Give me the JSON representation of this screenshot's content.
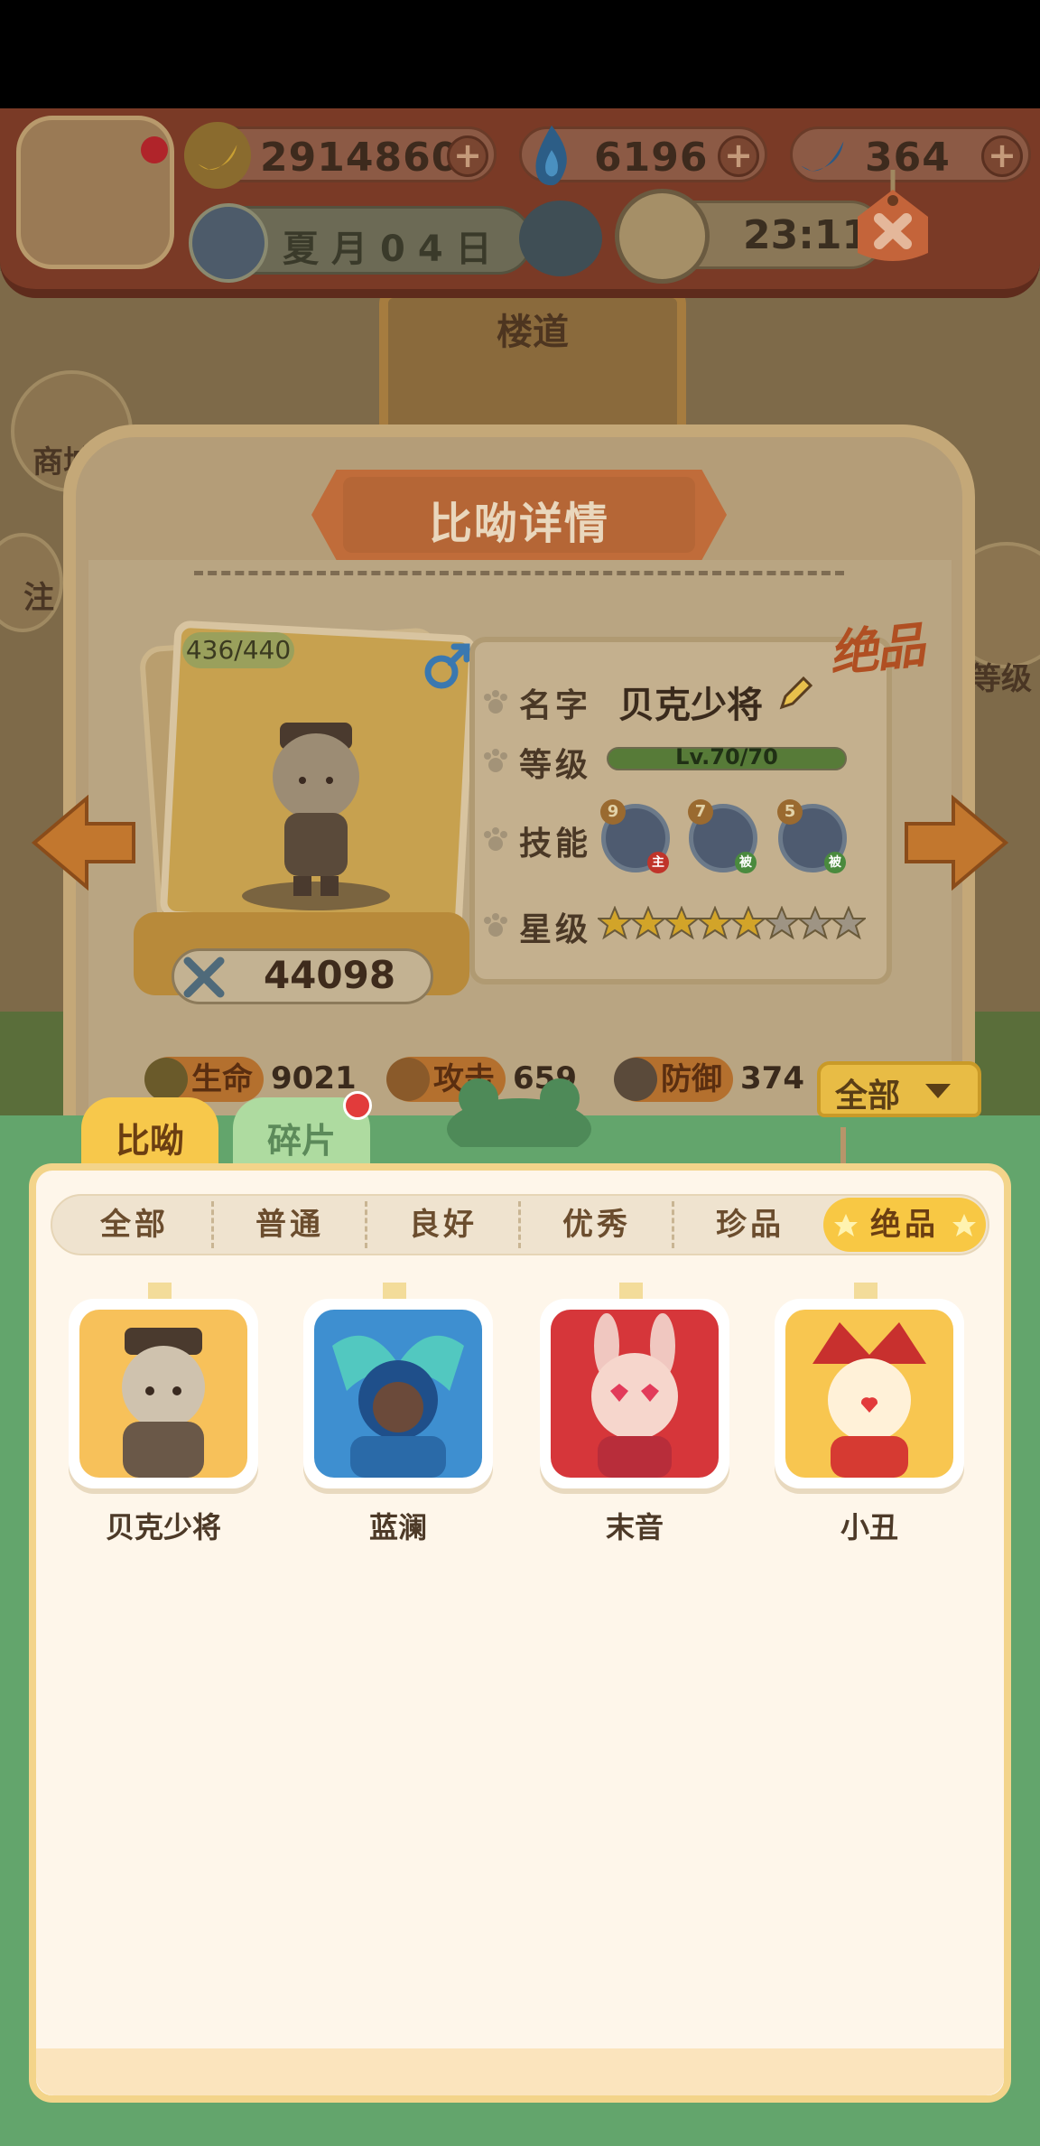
{
  "colors": {
    "sheet_green": "#63a56c",
    "tab_active": "#f7c84b",
    "panel_bg": "#fef6ea",
    "notification_red": "#e23b3b",
    "ribbon": "#c06c3a"
  },
  "header": {
    "resources": [
      {
        "icon": "banana-icon",
        "value": "2914860"
      },
      {
        "icon": "blue-flame-icon",
        "value": "6196"
      },
      {
        "icon": "blue-banana-icon",
        "value": "364"
      }
    ],
    "date_text": "夏月04日",
    "time_text": "23:11"
  },
  "scene": {
    "location_label": "楼道",
    "side_buttons": [
      "商城",
      "注",
      "等级"
    ]
  },
  "detail": {
    "title": "比呦详情",
    "rarity": "绝品",
    "card_level": "436/440",
    "power": "44098",
    "name_label": "名字",
    "name_value": "贝克少将",
    "level_label": "等级",
    "level_text": "Lv.70/70",
    "level_progress": 1.0,
    "skill_label": "技能",
    "skills": [
      {
        "level": "9",
        "tag": "主",
        "tag_color": "#c0342a",
        "icon": "wrench-skill-icon"
      },
      {
        "level": "7",
        "tag": "被",
        "tag_color": "#4a8a3e",
        "icon": "compass-skill-icon"
      },
      {
        "level": "5",
        "tag": "被",
        "tag_color": "#4a8a3e",
        "icon": "spike-skill-icon"
      }
    ],
    "star_label": "星级",
    "stars_filled": 5,
    "stars_total": 8,
    "stats": [
      {
        "label": "生命",
        "value": "9021",
        "icon": "turtle-icon"
      },
      {
        "label": "攻击",
        "value": "659",
        "icon": "bear-icon"
      },
      {
        "label": "防御",
        "value": "374",
        "icon": "cow-icon"
      }
    ]
  },
  "bottom": {
    "tabs": [
      {
        "label": "比呦",
        "active": true
      },
      {
        "label": "碎片",
        "active": false,
        "has_notification": true
      }
    ],
    "filter_dropdown": "全部",
    "rarity_filters": [
      "全部",
      "普通",
      "良好",
      "优秀",
      "珍品",
      "绝品"
    ],
    "active_filter": "绝品",
    "items": [
      {
        "name": "贝克少将",
        "color": "#f7c15a",
        "icon": "officer-cat-portrait"
      },
      {
        "name": "蓝澜",
        "color": "#3e8fd0",
        "icon": "blue-fairy-portrait"
      },
      {
        "name": "末音",
        "color": "#d6363a",
        "icon": "pink-bunny-portrait"
      },
      {
        "name": "小丑",
        "color": "#f8c650",
        "icon": "jester-cat-portrait"
      }
    ]
  }
}
